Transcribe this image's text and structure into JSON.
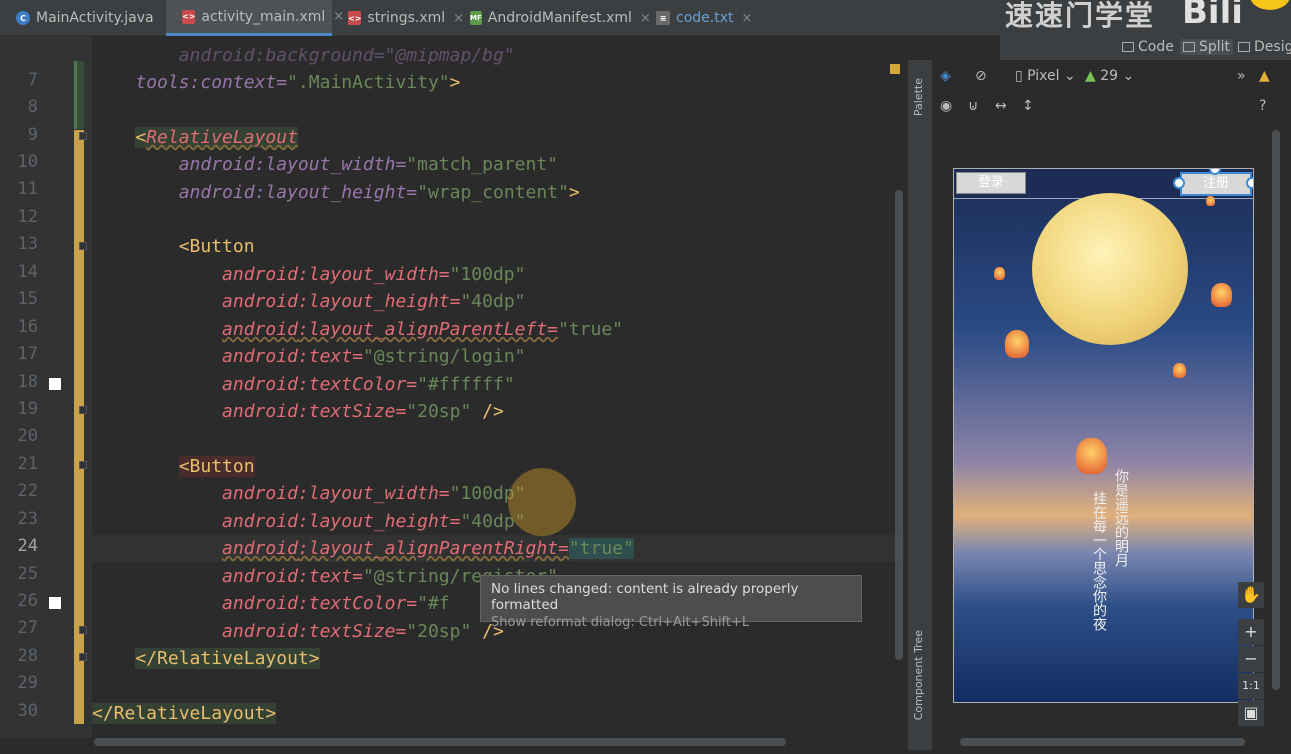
{
  "tabs": [
    {
      "label": "MainActivity.java",
      "icon": "C",
      "color": "#3f7dc7"
    },
    {
      "label": "activity_main.xml",
      "icon": "<>",
      "color": "#c94a4a"
    },
    {
      "label": "strings.xml",
      "icon": "<>",
      "color": "#c94a4a"
    },
    {
      "label": "AndroidManifest.xml",
      "icon": "MF",
      "color": "#5a9a48"
    },
    {
      "label": "code.txt",
      "icon": "≡",
      "color": "#9a9a9a"
    }
  ],
  "tab_close": "×",
  "watermark": {
    "text": "速速门学堂",
    "logo": "bilibili"
  },
  "view_modes": {
    "code": "Code",
    "split": "Split",
    "design": "Design"
  },
  "lines": {
    "n7": "7",
    "n8": "8",
    "n9": "9",
    "n10": "10",
    "n11": "11",
    "n12": "12",
    "n13": "13",
    "n14": "14",
    "n15": "15",
    "n16": "16",
    "n17": "17",
    "n18": "18",
    "n19": "19",
    "n20": "20",
    "n21": "21",
    "n22": "22",
    "n23": "23",
    "n24": "24",
    "n25": "25",
    "n26": "26",
    "n27": "27",
    "n28": "28",
    "n29": "29",
    "n30": "30"
  },
  "code": {
    "l6": "    android:background=\"@mipmap/bg\"",
    "l7_ns": "tools",
    "l7_attr": ":context=",
    "l7_val": "\".MainActivity\"",
    "l7_end": ">",
    "rl_open": "<RelativeLayout",
    "rl_name": "RelativeLayout",
    "lt": "<",
    "android": "android",
    "lw": ":layout_width=",
    "lh": ":layout_height=",
    "match": "\"match_parent\"",
    "wrap": "\"wrap_content\"",
    "gt": ">",
    "button": "Button",
    "v100": "\"100dp\"",
    "v40": "\"40dp\"",
    "apl": ":layout_alignParentLeft=",
    "apr": ":layout_alignParentRight=",
    "vtrue": "\"true\"",
    "text": ":text=",
    "login": "\"@string/login\"",
    "register": "\"@string/register\"",
    "tcolor": ":textColor=",
    "white": "\"#ffffff\"",
    "white_partial": "\"#f",
    "tsize": ":textSize=",
    "v20": "\"20sp\"",
    "selfclose": " />",
    "rl_close": "</RelativeLayout>",
    "rl_close_outer": "</RelativeLayout>"
  },
  "tooltip": {
    "title": "No lines changed: content is already properly formatted",
    "hint": "Show reformat dialog: Ctrl+Alt+Shift+L"
  },
  "side_panels": {
    "palette": "Palette",
    "component_tree": "Component Tree"
  },
  "design_toolbar": {
    "device": "Pixel",
    "api": "29",
    "more": "»"
  },
  "preview": {
    "login_label": "登录",
    "register_label": "注册",
    "poem_col1": "你是遥远的明月",
    "poem_col2": "挂在每一个思念你的夜"
  },
  "zoom": {
    "plus": "+",
    "minus": "−",
    "ratio": "1:1"
  },
  "colors": {
    "accent": "#4a88c7",
    "editor_bg": "#2b2b2b",
    "tag": "#e8bf6a",
    "attr": "#e06c75",
    "string": "#6a8759"
  }
}
